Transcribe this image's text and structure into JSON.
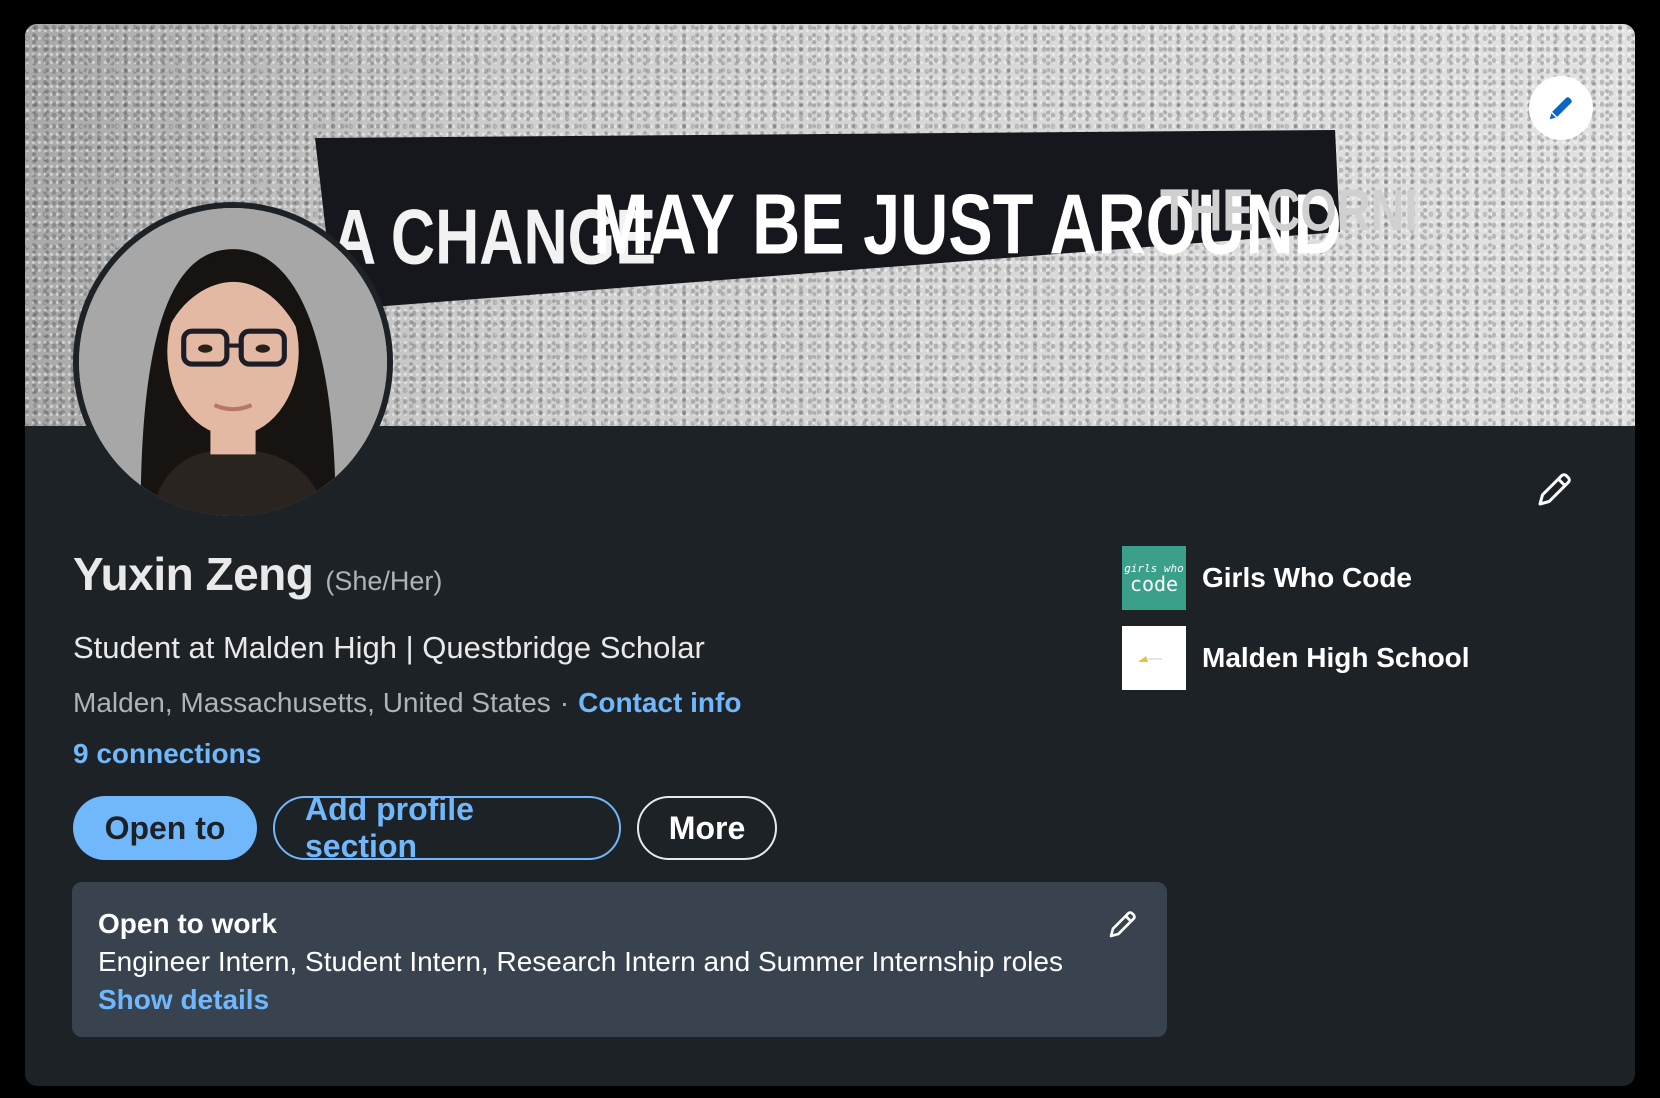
{
  "banner": {
    "text_part1": "A CHANGE",
    "text_part2": "MAY BE JUST AROUND",
    "text_part3": "THE CORNER"
  },
  "profile": {
    "name": "Yuxin Zeng",
    "pronouns": "(She/Her)",
    "headline": "Student at Malden High | Questbridge Scholar",
    "location": "Malden, Massachusetts, United States",
    "separator": "·",
    "contact_info": "Contact info",
    "connections": "9 connections"
  },
  "actions": {
    "open_to": "Open to",
    "add_section": "Add profile section",
    "more": "More"
  },
  "open_to_work": {
    "title": "Open to work",
    "roles": "Engineer Intern, Student Intern, Research Intern and Summer Internship roles",
    "show_details": "Show details"
  },
  "organizations": [
    {
      "name": "Girls Who Code",
      "logo_text_top": "girls who",
      "logo_text_bottom": "code"
    },
    {
      "name": "Malden High School"
    }
  ],
  "colors": {
    "card_bg": "#1d2226",
    "accent": "#71b7fb",
    "otw_bg": "#38434f",
    "gwc_green": "#3aa08a"
  },
  "icons": {
    "banner_edit": "pencil-icon",
    "intro_edit": "pencil-icon",
    "otw_edit": "pencil-icon"
  }
}
